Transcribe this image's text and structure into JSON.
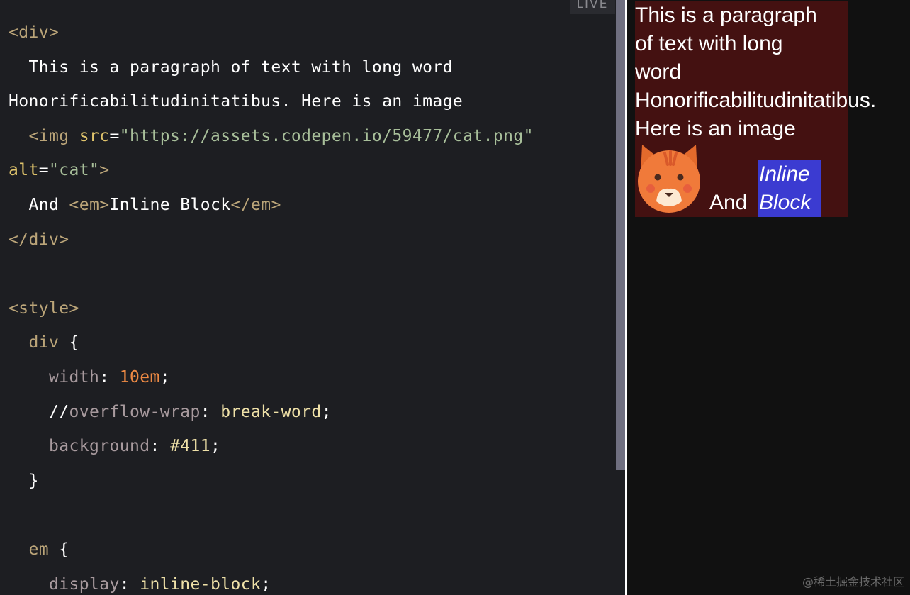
{
  "editor": {
    "live_badge": "LIVE",
    "lines": [
      [
        {
          "t": "tag",
          "v": "<div>"
        }
      ],
      [
        {
          "t": "punc",
          "v": "  This is a paragraph of text with long word"
        }
      ],
      [
        {
          "t": "punc",
          "v": "Honorificabilitudinitatibus. Here is an image"
        }
      ],
      [
        {
          "t": "tag",
          "v": "  <img "
        },
        {
          "t": "attr",
          "v": "src"
        },
        {
          "t": "punc",
          "v": "="
        },
        {
          "t": "str",
          "v": "\"https://assets.codepen.io/59477/cat.png\""
        }
      ],
      [
        {
          "t": "attr",
          "v": "alt"
        },
        {
          "t": "punc",
          "v": "="
        },
        {
          "t": "str",
          "v": "\"cat\""
        },
        {
          "t": "tag",
          "v": ">"
        }
      ],
      [
        {
          "t": "punc",
          "v": "  And "
        },
        {
          "t": "tag",
          "v": "<em>"
        },
        {
          "t": "punc",
          "v": "Inline Block"
        },
        {
          "t": "tag",
          "v": "</em>"
        }
      ],
      [
        {
          "t": "tag",
          "v": "</div>"
        }
      ],
      [],
      [
        {
          "t": "tag",
          "v": "<style>"
        }
      ],
      [
        {
          "t": "tag",
          "v": "  div "
        },
        {
          "t": "punc",
          "v": "{"
        }
      ],
      [
        {
          "t": "prop",
          "v": "    width"
        },
        {
          "t": "punc",
          "v": ": "
        },
        {
          "t": "num",
          "v": "10em"
        },
        {
          "t": "punc",
          "v": ";"
        }
      ],
      [
        {
          "t": "punc",
          "v": "    //"
        },
        {
          "t": "prop",
          "v": "overflow-wrap"
        },
        {
          "t": "punc",
          "v": ": "
        },
        {
          "t": "val",
          "v": "break-word"
        },
        {
          "t": "punc",
          "v": ";"
        }
      ],
      [
        {
          "t": "prop",
          "v": "    background"
        },
        {
          "t": "punc",
          "v": ": "
        },
        {
          "t": "val",
          "v": "#411"
        },
        {
          "t": "punc",
          "v": ";"
        }
      ],
      [
        {
          "t": "punc",
          "v": "  }"
        }
      ],
      [],
      [
        {
          "t": "tag",
          "v": "  em "
        },
        {
          "t": "punc",
          "v": "{"
        }
      ],
      [
        {
          "t": "prop",
          "v": "    display"
        },
        {
          "t": "punc",
          "v": ": "
        },
        {
          "t": "val",
          "v": "inline-block"
        },
        {
          "t": "punc",
          "v": ";"
        }
      ]
    ]
  },
  "preview": {
    "paragraph_lines": [
      "This is a paragraph",
      "of text with long",
      "word",
      "Honorificabilitudinitatibus.",
      "Here is an image"
    ],
    "and_text": "And",
    "em_line_1": "Inline",
    "em_line_2": "Block",
    "image_alt": "cat",
    "colors": {
      "box_background": "#441111",
      "em_background": "#3b3bd1",
      "cat_orange": "#f07a3a"
    }
  },
  "watermark": "@稀土掘金技术社区"
}
